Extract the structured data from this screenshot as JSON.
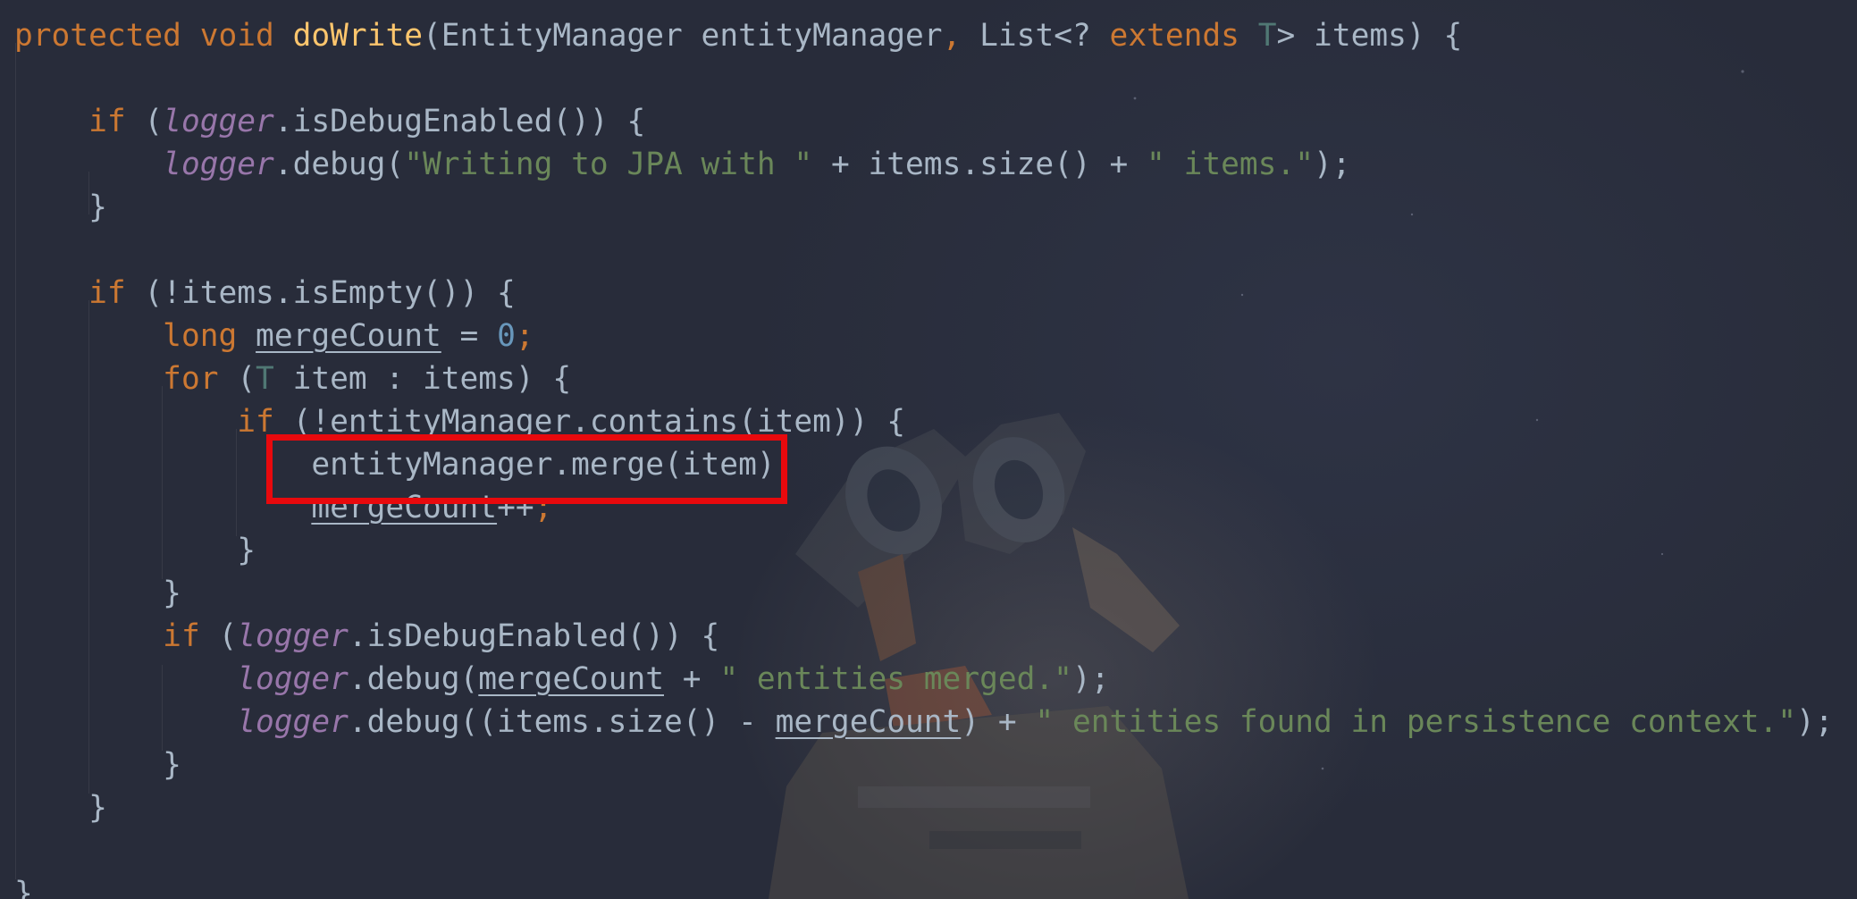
{
  "editor": {
    "colors": {
      "background": "#282c3a",
      "default_text": "#a9b7c6",
      "keyword": "#cc7832",
      "method_declaration": "#ffc66d",
      "static_field": "#9876aa",
      "string": "#6a8759",
      "number": "#6897bb",
      "type_parameter": "#507874",
      "highlight_box": "#e8090d"
    },
    "lines": [
      [
        "protected",
        " ",
        "void",
        " ",
        "doWrite",
        "(EntityManager entityManager",
        ",",
        " List<? ",
        "extends",
        " ",
        "T",
        "> items) {"
      ],
      [],
      [
        "    ",
        "if",
        " (",
        "logger",
        ".isDebugEnabled()) {"
      ],
      [
        "        ",
        "logger",
        ".debug(",
        "\"Writing to JPA with \"",
        " + items.size() + ",
        "\" items.\"",
        ");"
      ],
      [
        "    }"
      ],
      [],
      [
        "    ",
        "if",
        " (!items.isEmpty()) {"
      ],
      [
        "        ",
        "long",
        " ",
        "mergeCount",
        " = ",
        "0",
        ";"
      ],
      [
        "        ",
        "for",
        " (",
        "T",
        " item : items) {"
      ],
      [
        "            ",
        "if",
        " (!entityManager.contains(item)) {"
      ],
      [
        "                ",
        "entityManager.merge(item)",
        ";"
      ],
      [
        "                ",
        "mergeCount",
        "++",
        ";"
      ],
      [
        "            }"
      ],
      [
        "        }"
      ],
      [
        "        ",
        "if",
        " (",
        "logger",
        ".isDebugEnabled()) {"
      ],
      [
        "            ",
        "logger",
        ".debug(",
        "mergeCount",
        " + ",
        "\" entities merged.\"",
        ");"
      ],
      [
        "            ",
        "logger",
        ".debug((items.size() - ",
        "mergeCount",
        ") + ",
        "\" entities found in persistence context.\"",
        ");"
      ],
      [
        "        }"
      ],
      [
        "    }"
      ],
      [],
      [
        "}"
      ]
    ]
  }
}
